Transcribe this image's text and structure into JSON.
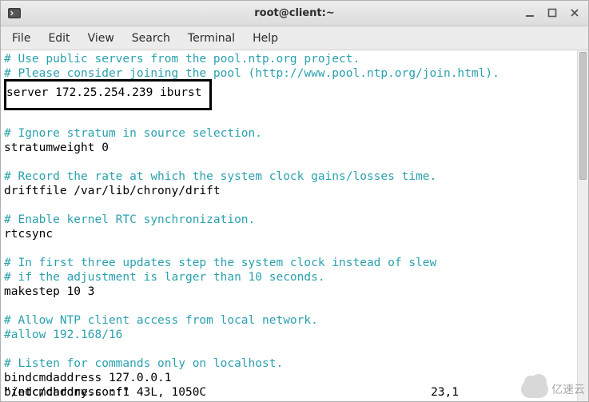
{
  "window": {
    "title": "root@client:~"
  },
  "menubar": {
    "items": [
      "File",
      "Edit",
      "View",
      "Search",
      "Terminal",
      "Help"
    ]
  },
  "terminal": {
    "line_comment_pool": "# Use public servers from the pool.ntp.org project.",
    "line_comment_join": "# Please consider joining the pool (http://www.pool.ntp.org/join.html).",
    "server_line": "server 172.25.254.239 iburst",
    "line_comment_stratum": "# Ignore stratum in source selection.",
    "stratum_line": "stratumweight 0",
    "line_comment_drift": "# Record the rate at which the system clock gains/losses time.",
    "drift_line": "driftfile /var/lib/chrony/drift",
    "line_comment_rtc": "# Enable kernel RTC synchronization.",
    "rtc_line": "rtcsync",
    "line_comment_step1": "# In first three updates step the system clock instead of slew",
    "line_comment_step2": "# if the adjustment is larger than 10 seconds.",
    "makestep_line": "makestep 10 3",
    "line_comment_allow": "# Allow NTP client access from local network.",
    "allow_line": "#allow 192.168/16",
    "line_comment_listen": "# Listen for commands only on localhost.",
    "bind_v4": "bindcmdaddress 127.0.0.1",
    "bind_v6": "bindcmdaddress ::1",
    "status_file": "\"/etc/chrony.conf\" 43L, 1050C",
    "status_pos": "23,1"
  },
  "watermark": {
    "text": "亿速云"
  }
}
